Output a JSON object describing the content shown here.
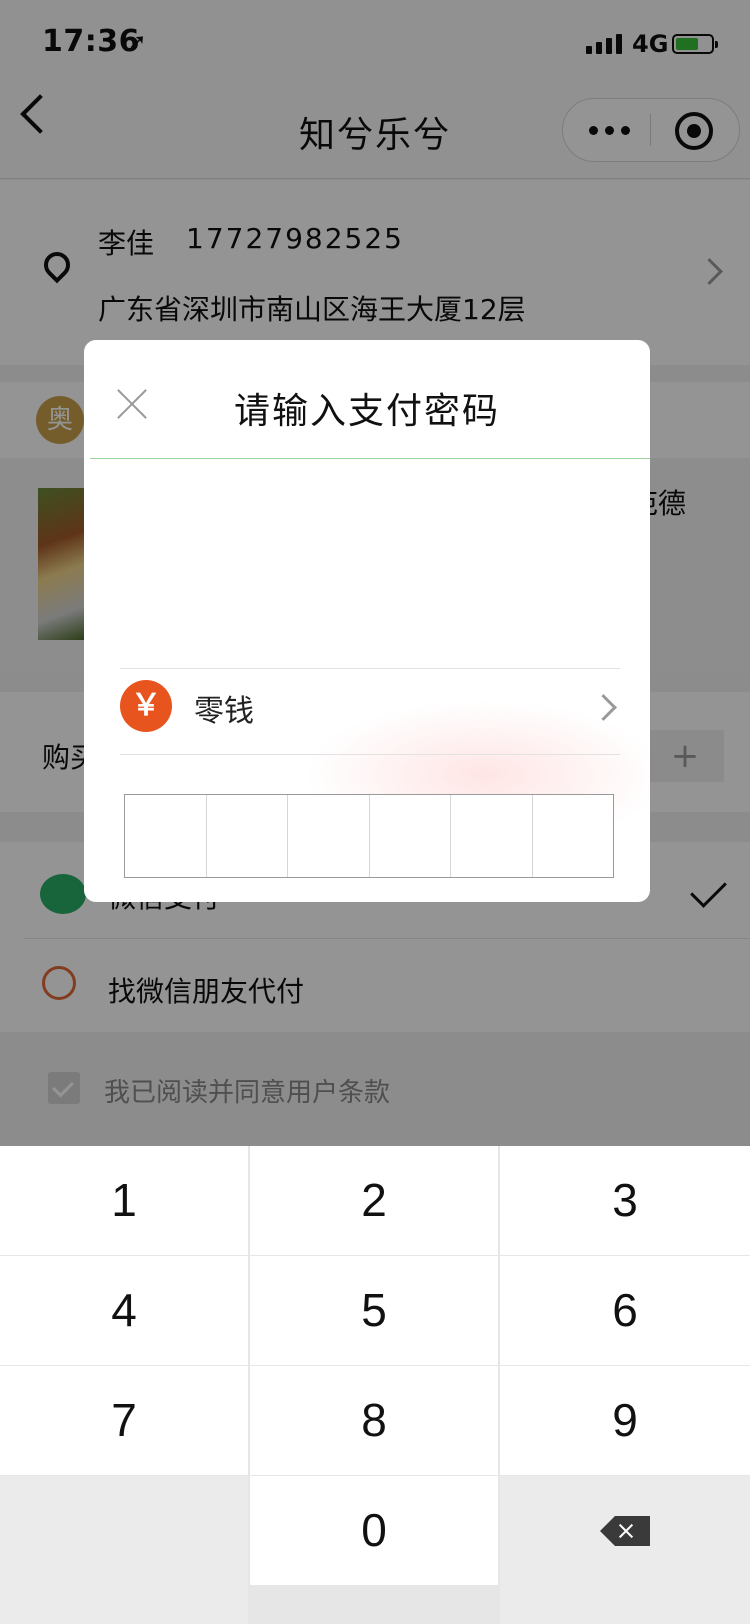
{
  "status_bar": {
    "time": "17:36",
    "network": "4G"
  },
  "nav": {
    "title": "知兮乐兮"
  },
  "address": {
    "name": "李佳",
    "phone": "17727982525",
    "detail": "广东省深圳市南山区海王大厦12层"
  },
  "shop": {
    "avatar_char": "奥"
  },
  "product": {
    "name_fragment": "范德"
  },
  "quantity": {
    "label_fragment": "购买",
    "plus": "+"
  },
  "payment": {
    "wechat_label": "微信支付",
    "friend_label": "找微信朋友代付",
    "agree_label": "我已阅读并同意用户条款"
  },
  "dialog": {
    "title": "请输入支付密码",
    "method_symbol": "￥",
    "method_label": "零钱"
  },
  "keypad": {
    "keys": [
      "1",
      "2",
      "3",
      "4",
      "5",
      "6",
      "7",
      "8",
      "9",
      "0"
    ]
  },
  "colors": {
    "wechat_green": "#2aae67",
    "change_orange": "#e8541e"
  }
}
